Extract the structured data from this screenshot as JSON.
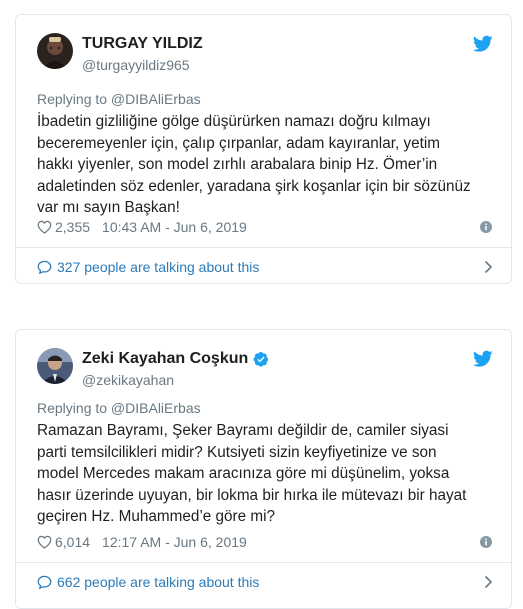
{
  "tweets": [
    {
      "author_name": "TURGAY YILDIZ",
      "handle": "@turgayyildiz965",
      "verified": false,
      "reply_context": "Replying to @DIBAliErbas",
      "text": "İbadetin gizliliğine gölge düşürürken namazı doğru kılmayı\nbeceremeyenler için, çalıp çırpanlar, adam kayıranlar, yetim\nhakkı yiyenler, son model zırhlı arabalara binip Hz. Ömer’in\nadaletinden söz edenler, yaradana şirk koşanlar için bir sözünüz\nvar mı sayın Başkan!",
      "likes": "2,355",
      "timestamp": "10:43 AM - Jun 6, 2019",
      "talking": "327 people are talking about this"
    },
    {
      "author_name": "Zeki Kayahan Coşkun",
      "handle": "@zekikayahan",
      "verified": true,
      "reply_context": "Replying to @DIBAliErbas",
      "text": "Ramazan Bayramı, Şeker Bayramı değildir de, camiler siyasi\nparti temsilcilikleri midir? Kutsiyeti sizin keyfiyetinize ve son\nmodel Mercedes makam aracınıza göre mi düşünelim, yoksa\nhasır üzerinde uyuyan, bir lokma bir hırka ile mütevazı bir hayat\ngeçiren Hz. Muhammed’e göre mi?",
      "likes": "6,014",
      "timestamp": "12:17 AM - Jun 6, 2019",
      "talking": "662 people are talking about this"
    }
  ],
  "colors": {
    "twitter_blue": "#1da1f2",
    "link_blue": "#2b7bb9",
    "muted": "#697882",
    "border": "#e1e8ed"
  },
  "icons": [
    "twitter-bird-icon",
    "heart-icon",
    "info-icon",
    "speech-bubble-icon",
    "chevron-right-icon",
    "verified-badge-icon"
  ]
}
